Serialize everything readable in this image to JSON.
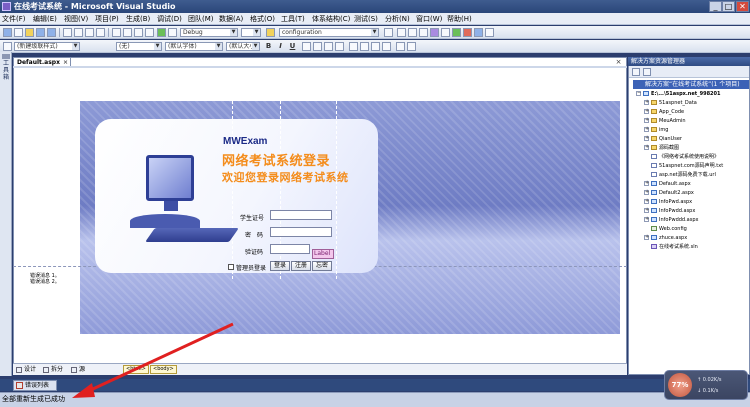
{
  "window": {
    "title": "在线考试系统 - Microsoft Visual Studio",
    "min": "_",
    "max": "□",
    "close": "✕"
  },
  "menu": [
    "文件(F)",
    "编辑(E)",
    "视图(V)",
    "项目(P)",
    "生成(B)",
    "调试(D)",
    "团队(M)",
    "数据(A)",
    "格式(O)",
    "工具(T)",
    "体系结构(C)",
    "测试(S)",
    "分析(N)",
    "窗口(W)",
    "帮助(H)"
  ],
  "toolbar1": {
    "config_combo": "Debug",
    "platform_combo": "configuration"
  },
  "toolbar2": {
    "block_format": "(新建级联样式)",
    "font_name": "(无)",
    "font_family": "(默认字体)",
    "font_size": "(默认大小)",
    "bold": "B",
    "italic": "I",
    "underline": "U"
  },
  "toolbox": {
    "label": "工具箱"
  },
  "document": {
    "tab_label": "Default.aspx",
    "tab_close": "×",
    "close_button": "×",
    "brand": "MWExam",
    "tagline1": "网络考试系统登录",
    "tagline2": "欢迎您登录网络考试系统",
    "fields": [
      {
        "label": "学生证号",
        "name": "student-id"
      },
      {
        "label": "密　码",
        "name": "password"
      },
      {
        "label": "验证码",
        "name": "captcha"
      }
    ],
    "label_control": "Label",
    "remember_text": "管理员登录",
    "buttons": [
      "登录",
      "注册",
      "忘密"
    ],
    "bullets": [
      "错误消息 1。",
      "错误消息 2。"
    ]
  },
  "view_tabs": {
    "design": "设计",
    "split": "拆分",
    "source": "源",
    "crumb1": "<html>",
    "crumb2": "<body>"
  },
  "solution_explorer": {
    "title": "解决方案资源管理器",
    "selected": "解决方案“在线考试系统”(1 个项目)",
    "root": "E:\\...\\51aspx.net_998201",
    "items": [
      {
        "label": "51aspnet_Data",
        "type": "folder",
        "expandable": true
      },
      {
        "label": "App_Code",
        "type": "folder",
        "expandable": true
      },
      {
        "label": "MeuAdmin",
        "type": "folder",
        "expandable": true
      },
      {
        "label": "img",
        "type": "folder",
        "expandable": true
      },
      {
        "label": "QianUser",
        "type": "folder",
        "expandable": true
      },
      {
        "label": "源码截图",
        "type": "folder",
        "expandable": true
      },
      {
        "label": "《网络考试系统使用说明》",
        "type": "file",
        "expandable": false
      },
      {
        "label": "51aspnet.com源码声明.txt",
        "type": "file",
        "expandable": false
      },
      {
        "label": "asp.net源码免费下载.url",
        "type": "file",
        "expandable": false
      },
      {
        "label": "Default.aspx",
        "type": "web",
        "expandable": true
      },
      {
        "label": "Default2.aspx",
        "type": "web",
        "expandable": true
      },
      {
        "label": "InfoPwd.aspx",
        "type": "web",
        "expandable": true
      },
      {
        "label": "InfoPwdd.aspx",
        "type": "web",
        "expandable": true
      },
      {
        "label": "InfoPwddd.aspx",
        "type": "web",
        "expandable": true
      },
      {
        "label": "Web.config",
        "type": "cfg",
        "expandable": false
      },
      {
        "label": "zhuce.aspx",
        "type": "web",
        "expandable": true
      },
      {
        "label": "在线考试系统.sln",
        "type": "sln",
        "expandable": false
      }
    ]
  },
  "error_list": {
    "label": "错误列表"
  },
  "status": {
    "text": "全部重新生成已成功"
  },
  "net_widget": {
    "percent": "77%",
    "up": "0.02K/s",
    "down": "0.1K/s"
  },
  "colors": {
    "accent": "#3c62b6",
    "tagline": "#f48c1b",
    "arrow": "#e02020"
  }
}
